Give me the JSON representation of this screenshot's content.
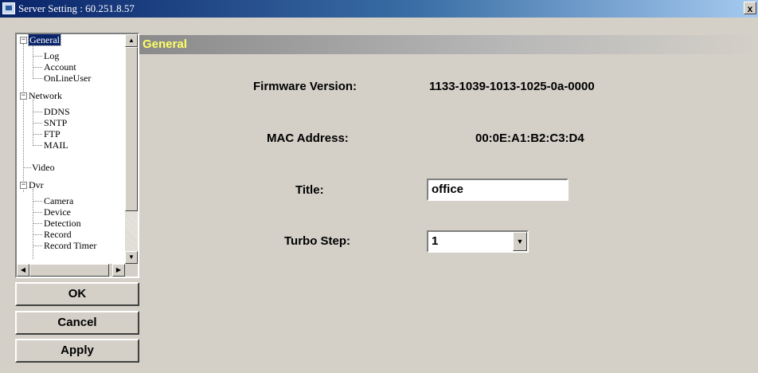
{
  "window": {
    "title": "Server Setting : 60.251.8.57",
    "close_glyph": "x"
  },
  "tree": {
    "items": [
      {
        "label": "General",
        "expander": "−",
        "selected": true
      },
      {
        "label": "Log"
      },
      {
        "label": "Account"
      },
      {
        "label": "OnLineUser"
      },
      {
        "label": "Network",
        "expander": "−"
      },
      {
        "label": "DDNS"
      },
      {
        "label": "SNTP"
      },
      {
        "label": "FTP"
      },
      {
        "label": "MAIL"
      },
      {
        "label": "Video"
      },
      {
        "label": "Dvr",
        "expander": "−"
      },
      {
        "label": "Camera"
      },
      {
        "label": "Device"
      },
      {
        "label": "Detection"
      },
      {
        "label": "Record"
      },
      {
        "label": "Record Timer"
      }
    ]
  },
  "buttons": {
    "ok": "OK",
    "cancel": "Cancel",
    "apply": "Apply"
  },
  "content": {
    "header": "General",
    "firmware_label": "Firmware Version:",
    "firmware_value": "1133-1039-1013-1025-0a-0000",
    "mac_label": "MAC Address:",
    "mac_value": "00:0E:A1:B2:C3:D4",
    "title_label": "Title:",
    "title_value": "office",
    "turbo_label": "Turbo Step:",
    "turbo_value": "1"
  },
  "colors": {
    "header_text": "#ffff66",
    "selection": "#0a246a"
  }
}
